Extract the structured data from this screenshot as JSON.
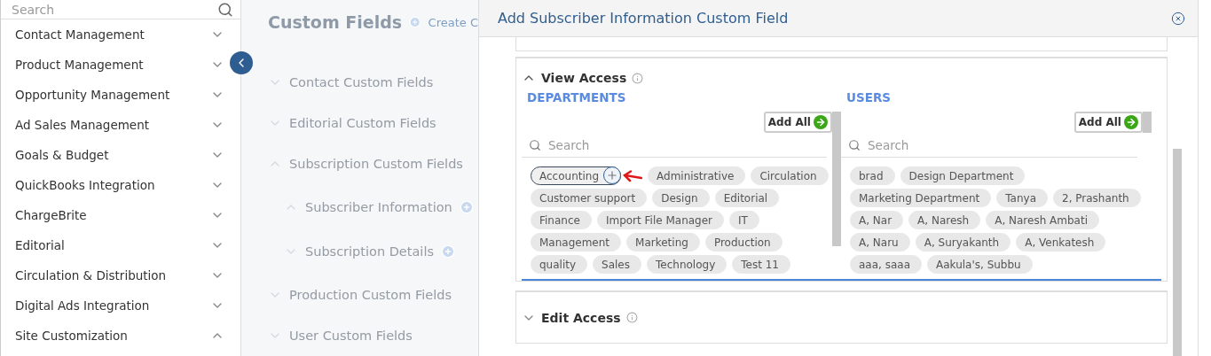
{
  "sidebar": {
    "search": {
      "placeholder": "Search"
    },
    "items": [
      {
        "label": "Contact Management",
        "expanded": false
      },
      {
        "label": "Product Management",
        "expanded": false
      },
      {
        "label": "Opportunity Management",
        "expanded": false
      },
      {
        "label": "Ad Sales Management",
        "expanded": false
      },
      {
        "label": "Goals & Budget",
        "expanded": false
      },
      {
        "label": "QuickBooks Integration",
        "expanded": false
      },
      {
        "label": "ChargeBrite",
        "expanded": false
      },
      {
        "label": "Editorial",
        "expanded": false
      },
      {
        "label": "Circulation & Distribution",
        "expanded": false
      },
      {
        "label": "Digital Ads Integration",
        "expanded": false
      },
      {
        "label": "Site Customization",
        "expanded": true
      }
    ]
  },
  "page": {
    "title": "Custom Fields",
    "create_link": "Create C",
    "sections": [
      {
        "label": "Contact Custom Fields",
        "expanded": false
      },
      {
        "label": "Editorial Custom Fields",
        "expanded": false
      },
      {
        "label": "Subscription Custom Fields",
        "expanded": true,
        "children": [
          {
            "label": "Subscriber Information",
            "expanded": true
          },
          {
            "label": "Subscription Details",
            "expanded": false
          }
        ]
      },
      {
        "label": "Production Custom Fields",
        "expanded": false
      },
      {
        "label": "User Custom Fields",
        "expanded": false
      }
    ]
  },
  "modal": {
    "title": "Add Subscriber Information Custom Field",
    "sections": [
      {
        "title": "View Access",
        "expanded": true,
        "lists": [
          {
            "heading": "DEPARTMENTS",
            "add_all": "Add All",
            "search": {
              "placeholder": "Search"
            },
            "chips": [
              {
                "label": "Accounting",
                "hovered": true
              },
              {
                "label": "Administrative",
                "hovered": false
              },
              {
                "label": "Circulation",
                "hovered": false
              },
              {
                "label": "Customer support",
                "hovered": false
              },
              {
                "label": "Design",
                "hovered": false
              },
              {
                "label": "Editorial",
                "hovered": false
              },
              {
                "label": "Finance",
                "hovered": false
              },
              {
                "label": "Import File Manager",
                "hovered": false
              },
              {
                "label": "IT",
                "hovered": false
              },
              {
                "label": "Management",
                "hovered": false
              },
              {
                "label": "Marketing",
                "hovered": false
              },
              {
                "label": "Production",
                "hovered": false
              },
              {
                "label": "quality",
                "hovered": false
              },
              {
                "label": "Sales",
                "hovered": false
              },
              {
                "label": "Technology",
                "hovered": false
              },
              {
                "label": "Test 11",
                "hovered": false
              }
            ]
          },
          {
            "heading": "USERS",
            "add_all": "Add All",
            "search": {
              "placeholder": "Search"
            },
            "chips": [
              {
                "label": "brad",
                "hovered": false
              },
              {
                "label": "Design Department",
                "hovered": false
              },
              {
                "label": "Marketing Department",
                "hovered": false
              },
              {
                "label": "Tanya",
                "hovered": false
              },
              {
                "label": "2, Prashanth",
                "hovered": false
              },
              {
                "label": "A, Nar",
                "hovered": false
              },
              {
                "label": "A, Naresh",
                "hovered": false
              },
              {
                "label": "A, Naresh Ambati",
                "hovered": false
              },
              {
                "label": "A, Naru",
                "hovered": false
              },
              {
                "label": "A, Suryakanth",
                "hovered": false
              },
              {
                "label": "A, Venkatesh",
                "hovered": false
              },
              {
                "label": "aaa, saaa",
                "hovered": false
              },
              {
                "label": "Aakula's, Subbu",
                "hovered": false
              }
            ]
          }
        ]
      },
      {
        "title": "Edit Access",
        "expanded": false
      }
    ]
  }
}
